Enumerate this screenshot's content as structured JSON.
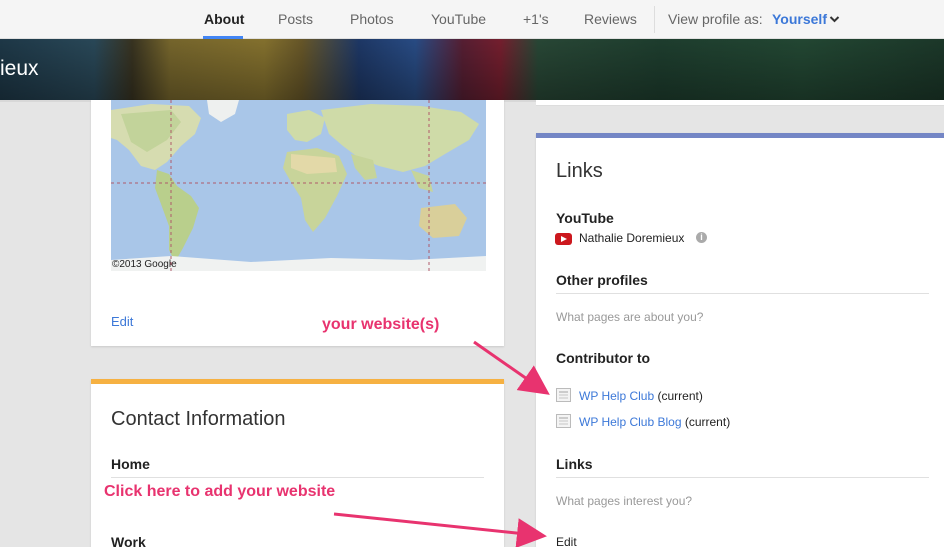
{
  "nav": {
    "tabs": [
      {
        "label": "About"
      },
      {
        "label": "Posts"
      },
      {
        "label": "Photos"
      },
      {
        "label": "YouTube"
      },
      {
        "label": "+1's"
      },
      {
        "label": "Reviews"
      }
    ],
    "view_profile_label": "View profile as:",
    "view_profile_value": "Yourself",
    "chevron_icon": "chevron-down-icon"
  },
  "cover": {
    "name": "ieux"
  },
  "map_card": {
    "credit": "©2013 Google",
    "edit_label": "Edit"
  },
  "contact_card": {
    "title": "Contact Information",
    "home_label": "Home",
    "work_label": "Work",
    "accent_color": "#f6b142"
  },
  "links_card": {
    "title": "Links",
    "accent_color": "#7486c5",
    "youtube_heading": "YouTube",
    "youtube_channel": "Nathalie Doremieux",
    "other_profiles_heading": "Other profiles",
    "other_profiles_placeholder": "What pages are about you?",
    "contributor_heading": "Contributor to",
    "contributor_items": [
      {
        "name": "WP Help Club",
        "status": "(current)"
      },
      {
        "name": "WP Help Club Blog",
        "status": "(current)"
      }
    ],
    "links_heading": "Links",
    "links_placeholder": "What pages interest you?",
    "edit_label": "Edit"
  },
  "annotations": {
    "website_note": "your website(s)",
    "add_note": "Click here to add your website",
    "color": "#e8336f"
  }
}
